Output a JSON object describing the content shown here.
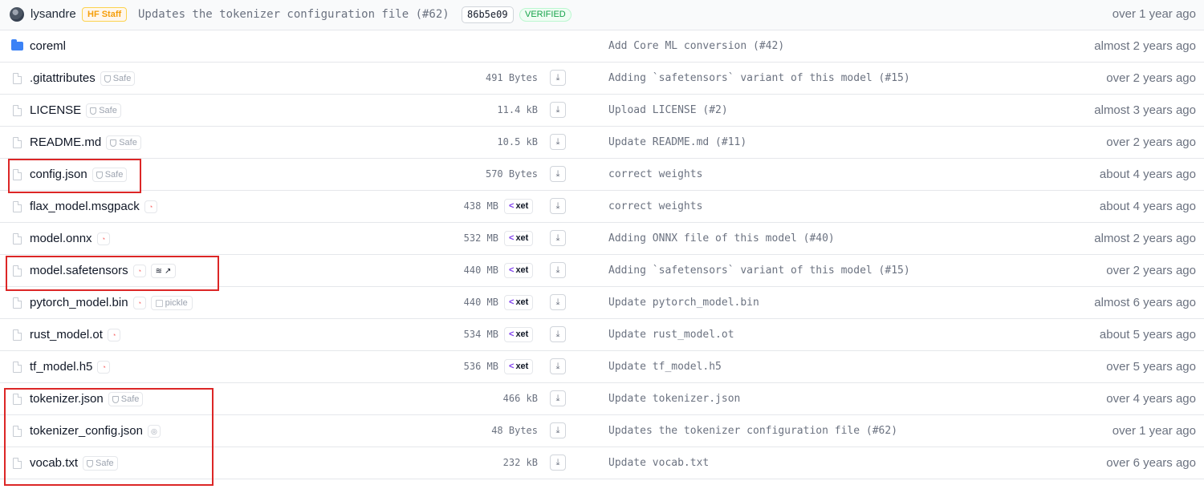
{
  "commit": {
    "author": "lysandre",
    "badge": "HF Staff",
    "message": "Updates the tokenizer configuration file (#62)",
    "sha": "86b5e09",
    "verified": "VERIFIED",
    "time": "over 1 year ago"
  },
  "folder": {
    "name": "coreml",
    "commit_message": "Add Core ML conversion (#42)",
    "time": "almost 2 years ago"
  },
  "files": [
    {
      "name": ".gitattributes",
      "badge": "Safe",
      "size": "491 Bytes",
      "commit_message": "Adding `safetensors` variant of this model (#15)",
      "time": "over 2 years ago"
    },
    {
      "name": "LICENSE",
      "badge": "Safe",
      "size": "11.4 kB",
      "commit_message": "Upload LICENSE (#2)",
      "time": "almost 3 years ago"
    },
    {
      "name": "README.md",
      "badge": "Safe",
      "size": "10.5 kB",
      "commit_message": "Update README.md (#11)",
      "time": "over 2 years ago"
    },
    {
      "name": "config.json",
      "badge": "Safe",
      "size": "570 Bytes",
      "commit_message": "correct weights",
      "time": "about 4 years ago"
    },
    {
      "name": "flax_model.msgpack",
      "size": "438 MB",
      "storage": "xet",
      "commit_message": "correct weights",
      "time": "about 4 years ago"
    },
    {
      "name": "model.onnx",
      "size": "532 MB",
      "storage": "xet",
      "commit_message": "Adding ONNX file of this model (#40)",
      "time": "almost 2 years ago"
    },
    {
      "name": "model.safetensors",
      "size": "440 MB",
      "storage": "xet",
      "commit_message": "Adding `safetensors` variant of this model (#15)",
      "time": "over 2 years ago"
    },
    {
      "name": "pytorch_model.bin",
      "badge": "pickle",
      "size": "440 MB",
      "storage": "xet",
      "commit_message": "Update pytorch_model.bin",
      "time": "almost 6 years ago"
    },
    {
      "name": "rust_model.ot",
      "size": "534 MB",
      "storage": "xet",
      "commit_message": "Update rust_model.ot",
      "time": "about 5 years ago"
    },
    {
      "name": "tf_model.h5",
      "size": "536 MB",
      "storage": "xet",
      "commit_message": "Update tf_model.h5",
      "time": "over 5 years ago"
    },
    {
      "name": "tokenizer.json",
      "badge": "Safe",
      "size": "466 kB",
      "commit_message": "Update tokenizer.json",
      "time": "over 4 years ago"
    },
    {
      "name": "tokenizer_config.json",
      "size": "48 Bytes",
      "commit_message": "Updates the tokenizer configuration file (#62)",
      "time": "over 1 year ago"
    },
    {
      "name": "vocab.txt",
      "badge": "Safe",
      "size": "232 kB",
      "commit_message": "Update vocab.txt",
      "time": "over 6 years ago"
    }
  ],
  "colors": {
    "highlight": "#dc2626",
    "folder": "#3b82f6",
    "xet": "#7c3aed",
    "verified": "#16a34a",
    "staff": "#f59e0b"
  }
}
